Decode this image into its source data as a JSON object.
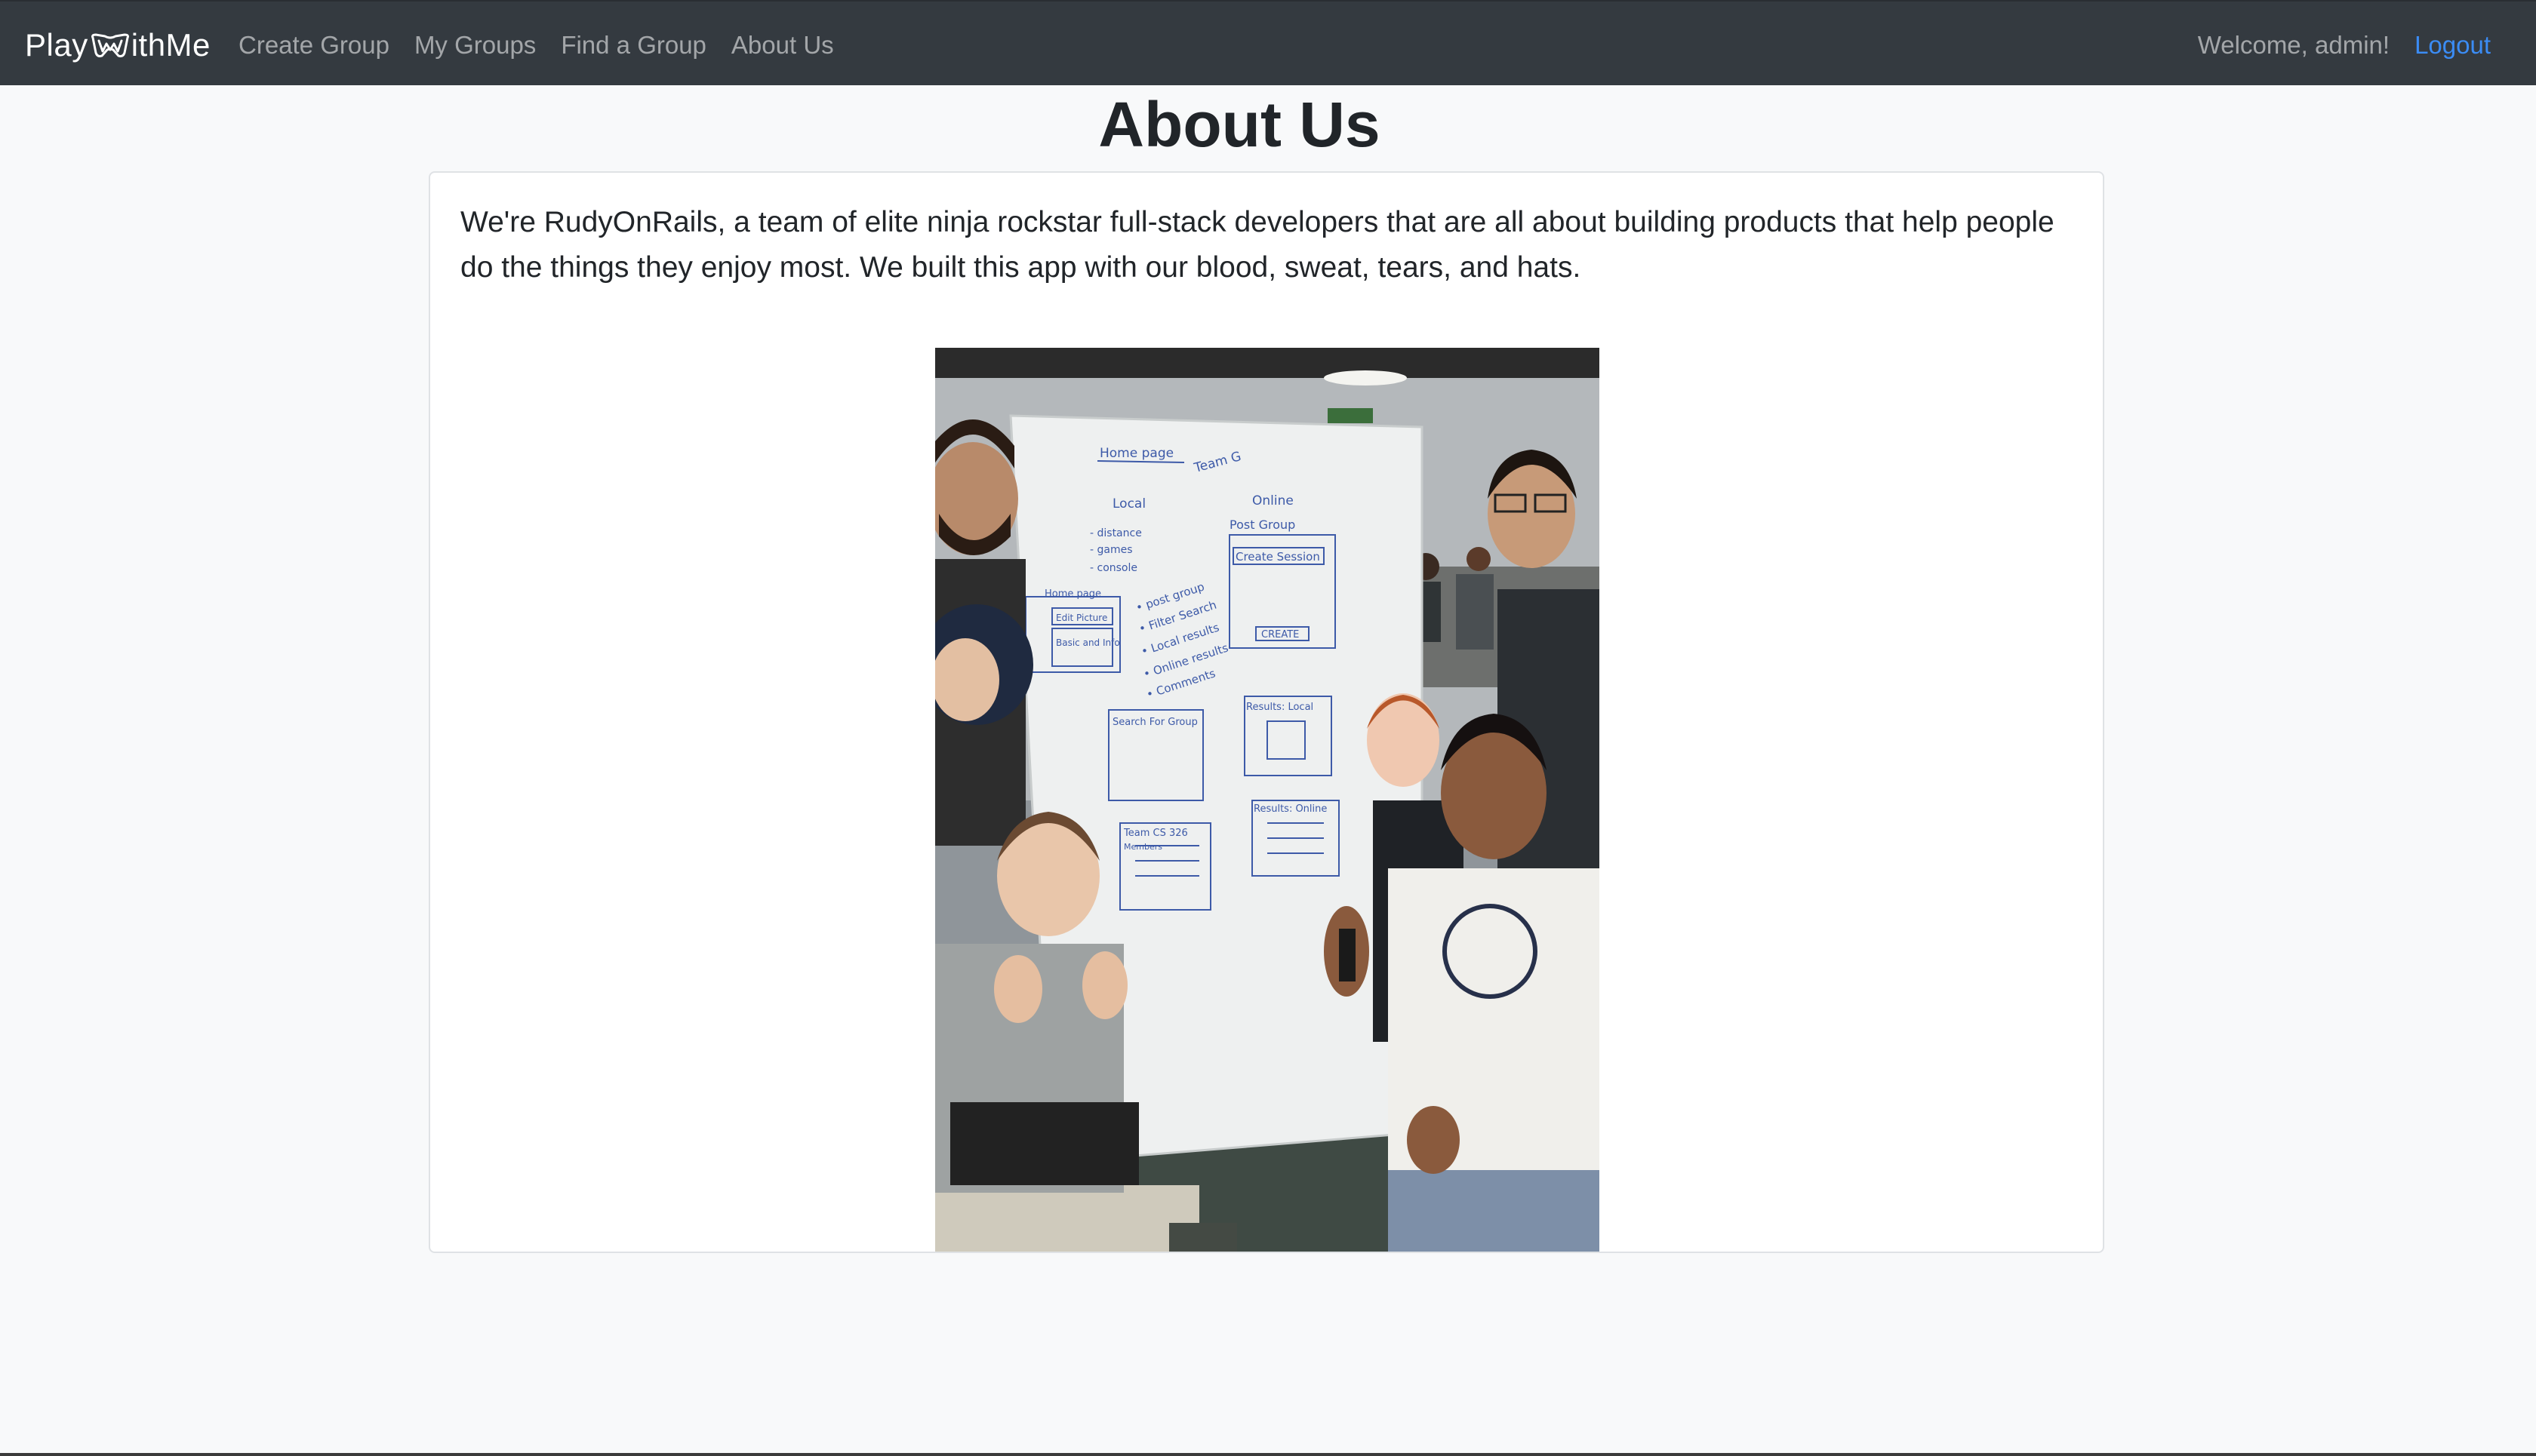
{
  "navbar": {
    "brand": {
      "prefix": "Play",
      "suffix": "ithMe",
      "logo_icon": "controller-w-icon"
    },
    "links": [
      {
        "label": "Create Group"
      },
      {
        "label": "My Groups"
      },
      {
        "label": "Find a Group"
      },
      {
        "label": "About Us"
      }
    ],
    "welcome_text": "Welcome, admin!",
    "logout_label": "Logout"
  },
  "page": {
    "title": "About Us",
    "intro": "We're RudyOnRails, a team of elite ninja rockstar full-stack developers that are all about building products that help people do the things they enjoy most. We built this app with our blood, sweat, tears, and hats.",
    "whiteboard": {
      "heading": "Home page",
      "team": "Team G",
      "col_local": "Local",
      "col_online": "Online",
      "list_items": [
        "- distance",
        "- games",
        "- console"
      ],
      "post_group": "Post Group",
      "create_session": "Create Session",
      "create_button": "CREATE",
      "bullets": [
        "• post group",
        "• Filter Search",
        "• Local results",
        "• Online results",
        "• Comments"
      ],
      "edit_picture": "Edit Picture",
      "basic_info": "Basic and Info",
      "search_box": "Search For Group",
      "results_local": "Results: Local",
      "results_online": "Results: Online",
      "team_box": "Team CS 326",
      "members": "Members"
    }
  }
}
